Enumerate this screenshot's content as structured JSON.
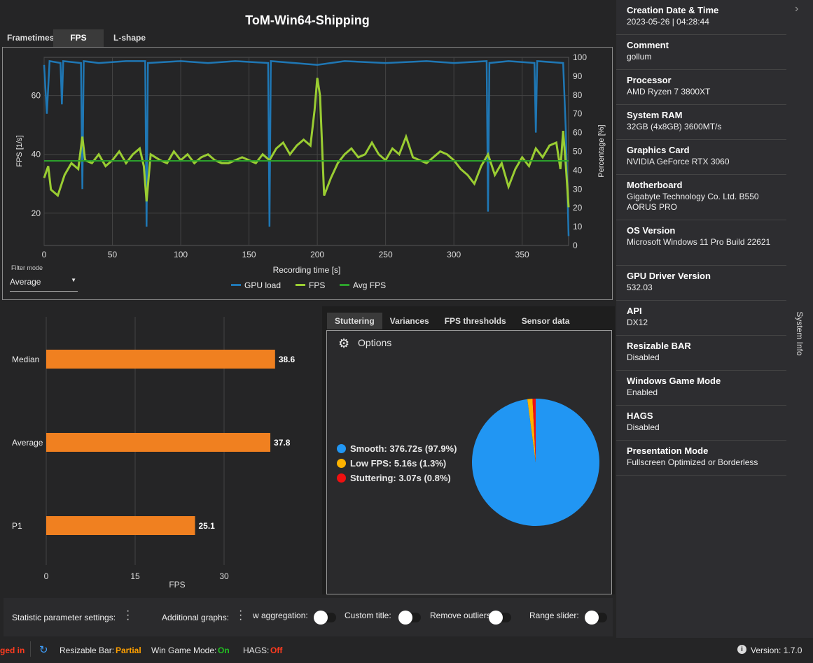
{
  "title": "ToM-Win64-Shipping",
  "tabs": [
    "Frametimes",
    "FPS",
    "L-shape"
  ],
  "active_tab": "FPS",
  "main_chart": {
    "type": "line",
    "xlabel": "Recording time [s]",
    "ylabel_left": "FPS [1/s]",
    "ylabel_right": "Percentage [%]",
    "x_ticks": [
      0,
      50,
      100,
      150,
      200,
      250,
      300,
      350
    ],
    "y_left_ticks": [
      20,
      40,
      60
    ],
    "y_right_ticks": [
      0,
      10,
      20,
      30,
      40,
      50,
      60,
      70,
      80,
      90,
      100
    ],
    "xlim": [
      0,
      384
    ],
    "ylim_left": [
      9,
      73
    ],
    "ylim_right": [
      0,
      100
    ],
    "legend": [
      "GPU load",
      "FPS",
      "Avg FPS"
    ],
    "colors": {
      "gpu": "#1f77b4",
      "fps": "#9acd32",
      "avg": "#2ca02c"
    },
    "avg_fps": 37.8,
    "fps": [
      [
        0,
        32
      ],
      [
        3,
        36
      ],
      [
        5,
        28
      ],
      [
        10,
        26
      ],
      [
        15,
        33
      ],
      [
        20,
        37
      ],
      [
        25,
        35
      ],
      [
        28,
        46
      ],
      [
        30,
        38
      ],
      [
        35,
        37
      ],
      [
        40,
        40
      ],
      [
        45,
        36
      ],
      [
        50,
        38
      ],
      [
        55,
        41
      ],
      [
        60,
        37
      ],
      [
        65,
        40
      ],
      [
        70,
        42
      ],
      [
        73,
        36
      ],
      [
        75,
        24
      ],
      [
        78,
        40
      ],
      [
        85,
        38
      ],
      [
        90,
        37
      ],
      [
        95,
        41
      ],
      [
        100,
        38
      ],
      [
        105,
        40
      ],
      [
        110,
        37
      ],
      [
        115,
        39
      ],
      [
        120,
        40
      ],
      [
        125,
        38
      ],
      [
        130,
        37
      ],
      [
        135,
        37
      ],
      [
        140,
        38
      ],
      [
        145,
        39
      ],
      [
        150,
        38
      ],
      [
        155,
        37
      ],
      [
        160,
        40
      ],
      [
        165,
        38
      ],
      [
        170,
        42
      ],
      [
        175,
        44
      ],
      [
        180,
        40
      ],
      [
        185,
        43
      ],
      [
        190,
        45
      ],
      [
        195,
        43
      ],
      [
        198,
        55
      ],
      [
        200,
        66
      ],
      [
        202,
        60
      ],
      [
        205,
        26
      ],
      [
        210,
        32
      ],
      [
        215,
        37
      ],
      [
        220,
        40
      ],
      [
        225,
        42
      ],
      [
        230,
        39
      ],
      [
        235,
        40
      ],
      [
        240,
        44
      ],
      [
        245,
        40
      ],
      [
        250,
        38
      ],
      [
        255,
        42
      ],
      [
        260,
        40
      ],
      [
        265,
        46
      ],
      [
        270,
        39
      ],
      [
        275,
        38
      ],
      [
        280,
        37
      ],
      [
        285,
        39
      ],
      [
        290,
        41
      ],
      [
        295,
        40
      ],
      [
        300,
        38
      ],
      [
        305,
        35
      ],
      [
        310,
        33
      ],
      [
        315,
        30
      ],
      [
        320,
        36
      ],
      [
        325,
        40
      ],
      [
        330,
        33
      ],
      [
        335,
        37
      ],
      [
        340,
        29
      ],
      [
        345,
        35
      ],
      [
        350,
        39
      ],
      [
        355,
        36
      ],
      [
        360,
        42
      ],
      [
        365,
        39
      ],
      [
        370,
        43
      ],
      [
        375,
        44
      ],
      [
        378,
        35
      ],
      [
        380,
        48
      ],
      [
        382,
        36
      ],
      [
        384,
        22
      ]
    ],
    "gpu_load": [
      [
        0,
        96
      ],
      [
        2,
        70
      ],
      [
        4,
        98
      ],
      [
        12,
        97
      ],
      [
        13,
        75
      ],
      [
        14,
        98
      ],
      [
        27,
        97
      ],
      [
        28,
        30
      ],
      [
        29,
        98
      ],
      [
        40,
        97
      ],
      [
        60,
        98
      ],
      [
        74,
        98
      ],
      [
        75,
        10
      ],
      [
        76,
        97
      ],
      [
        100,
        98
      ],
      [
        120,
        97
      ],
      [
        140,
        98
      ],
      [
        164,
        97
      ],
      [
        165,
        10
      ],
      [
        166,
        98
      ],
      [
        200,
        96
      ],
      [
        220,
        98
      ],
      [
        250,
        97
      ],
      [
        280,
        98
      ],
      [
        300,
        97
      ],
      [
        324,
        98
      ],
      [
        325,
        18
      ],
      [
        326,
        97
      ],
      [
        340,
        98
      ],
      [
        359,
        97
      ],
      [
        360,
        60
      ],
      [
        361,
        98
      ],
      [
        380,
        97
      ],
      [
        382,
        60
      ],
      [
        384,
        5
      ]
    ]
  },
  "filter": {
    "label": "Filter mode",
    "value": "Average"
  },
  "bar_chart": {
    "type": "bar",
    "categories": [
      "Median",
      "Average",
      "P1"
    ],
    "values": [
      38.6,
      37.8,
      25.1
    ],
    "x_ticks": [
      0,
      15,
      30
    ],
    "xlabel": "FPS",
    "xlim": [
      0,
      40
    ],
    "color": "#f08020"
  },
  "stat_tabs": [
    "Stuttering",
    "Variances",
    "FPS thresholds",
    "Sensor data"
  ],
  "options_label": "Options",
  "pie": {
    "type": "pie",
    "legend": [
      "Smooth:  376.72s (97.9%)",
      "Low FPS:  5.16s (1.3%)",
      "Stuttering:  3.07s (0.8%)"
    ],
    "values": [
      97.9,
      1.3,
      0.8
    ],
    "colors": [
      "#2196f3",
      "#ffb300",
      "#f01010"
    ]
  },
  "settings": {
    "stat_params": "Statistic parameter settings:",
    "additional_graphs": "Additional graphs:",
    "aggregation": "w aggregation:",
    "custom_title": "Custom title:",
    "remove_outliers": "Remove outliers:",
    "range_slider": "Range slider:"
  },
  "status": {
    "logged": "ged in",
    "rebar_label": "Resizable Bar:",
    "rebar_value": "Partial",
    "gamemode_label": "Win Game Mode:",
    "gamemode_value": "On",
    "hags_label": "HAGS:",
    "hags_value": "Off",
    "version": "Version: 1.7.0"
  },
  "sidebar": {
    "title": "System Info",
    "items": [
      {
        "k": "Creation Date & Time",
        "v": "2023-05-26  |  04:28:44"
      },
      {
        "k": "Comment",
        "v": "gollum"
      },
      {
        "k": "Processor",
        "v": "AMD Ryzen 7 3800XT"
      },
      {
        "k": "System RAM",
        "v": "32GB (4x8GB) 3600MT/s"
      },
      {
        "k": "Graphics Card",
        "v": "NVIDIA GeForce RTX 3060"
      },
      {
        "k": "Motherboard",
        "v": "Gigabyte Technology Co. Ltd. B550 AORUS PRO"
      },
      {
        "k": "OS Version",
        "v": "Microsoft Windows 11 Pro Build 22621"
      },
      {
        "k": "GPU Driver Version",
        "v": "532.03"
      },
      {
        "k": "API",
        "v": "DX12"
      },
      {
        "k": "Resizable BAR",
        "v": "Disabled"
      },
      {
        "k": "Windows Game Mode",
        "v": "Enabled"
      },
      {
        "k": "HAGS",
        "v": "Disabled"
      },
      {
        "k": "Presentation Mode",
        "v": "Fullscreen Optimized or Borderless"
      }
    ]
  }
}
